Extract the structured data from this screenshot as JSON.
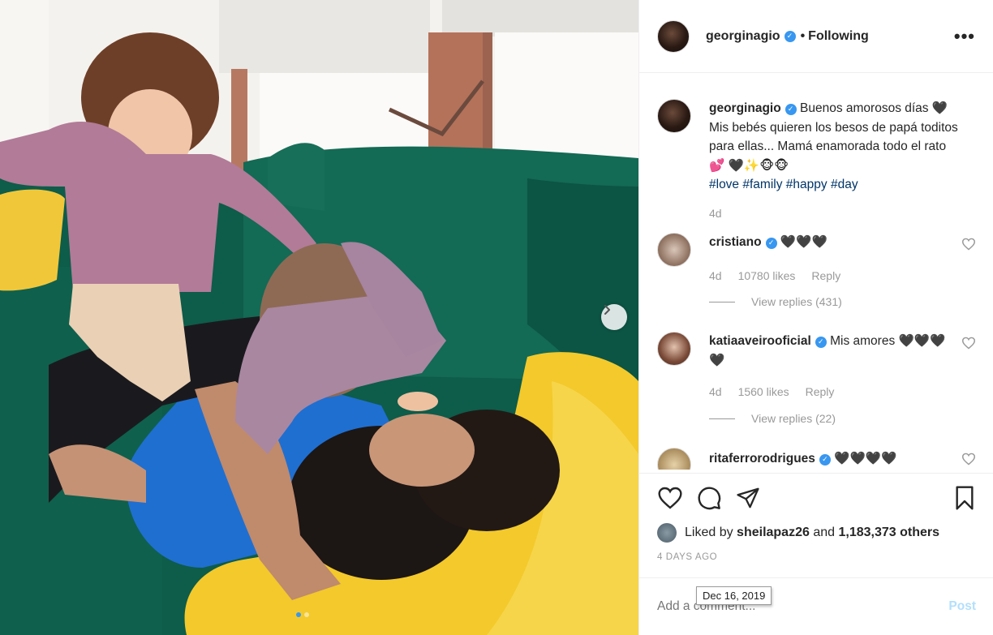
{
  "post": {
    "author": "georginagio",
    "follow_status": "Following",
    "more_glyph": "•••",
    "separator": "•"
  },
  "caption": {
    "username": "georginagio",
    "text": "Buenos amorosos días 🖤 Mis bebés quieren los besos de papá toditos para ellas... Mamá enamorada todo el rato💕 🖤✨🐵🐵",
    "hashtags": [
      "#love",
      "#family",
      "#happy",
      "#day"
    ],
    "age": "4d"
  },
  "comments": [
    {
      "username": "cristiano",
      "text": "🖤🖤🖤",
      "age": "4d",
      "likes": "10780 likes",
      "reply": "Reply",
      "view_replies": "View replies (431)"
    },
    {
      "username": "katiaaveirooficial",
      "text": "Mis amores 🖤🖤🖤🖤",
      "age": "4d",
      "likes": "1560 likes",
      "reply": "Reply",
      "view_replies": "View replies (22)"
    },
    {
      "username": "ritaferrorodrigues",
      "text": "🖤🖤🖤🖤"
    }
  ],
  "likes": {
    "prefix": "Liked by",
    "user": "sheilapaz26",
    "middle": "and",
    "others": "1,183,373 others"
  },
  "timestamp": {
    "ago": "4 DAYS AGO",
    "tooltip": "Dec 16, 2019"
  },
  "add_comment": {
    "placeholder": "Add a comment...",
    "post_label": "Post"
  },
  "icons": [
    "verified-badge-icon",
    "more-options-icon",
    "heart-icon",
    "comment-icon",
    "share-icon",
    "save-icon",
    "next-arrow-icon"
  ],
  "colors": {
    "accent": "#3897f0",
    "hashtag": "#003569",
    "muted": "#999999",
    "post_disabled": "#b2dffc"
  },
  "carousel": {
    "slide_count": 2,
    "active_index": 0
  }
}
